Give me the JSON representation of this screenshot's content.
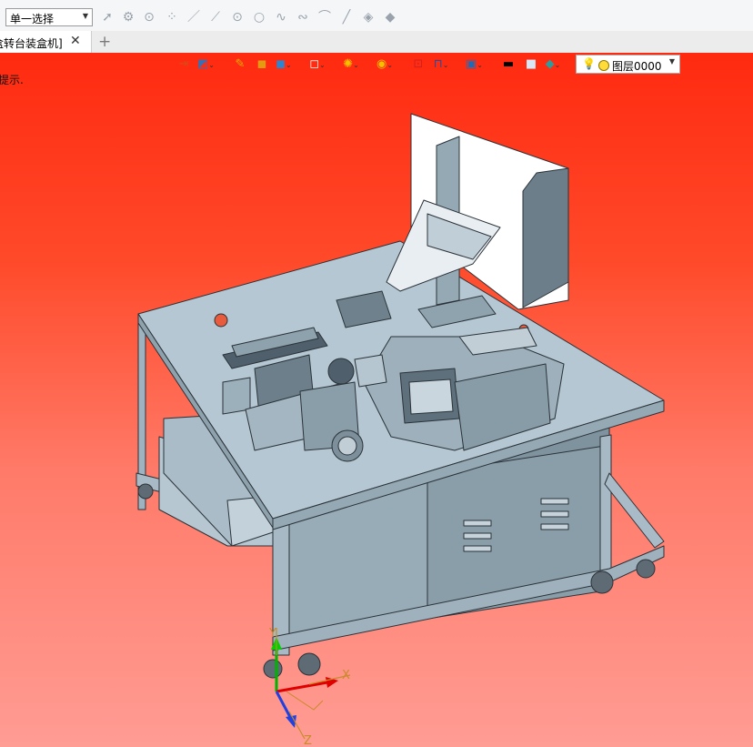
{
  "toolbar": {
    "selection_mode": "单一选择",
    "icons": [
      "cursor-icon",
      "pick-filter-icon",
      "play-icon",
      "points-icon",
      "line-icon",
      "segment-icon",
      "point-circle-icon",
      "circle-icon",
      "spline-icon",
      "curve-icon",
      "arc-icon",
      "pen-icon",
      "surface-icon",
      "surface2-icon"
    ]
  },
  "tabs": [
    {
      "label": "盒转台装盒机]",
      "close": "✕"
    }
  ],
  "add_tab": "+",
  "viewport": {
    "hint": "提示.",
    "layer_label": "图层0000",
    "axis_labels": {
      "x": "X",
      "y": "Y",
      "z": "Z"
    },
    "view_toolbar": [
      "exit-icon",
      "view-icon",
      "pen-icon",
      "box-icon",
      "cube-icon",
      "white-cube-icon",
      "palette-icon",
      "zoom-icon",
      "fit-icon",
      "section-icon",
      "display-icon",
      "black-rect-icon",
      "white-rect-icon",
      "plane-icon"
    ]
  }
}
